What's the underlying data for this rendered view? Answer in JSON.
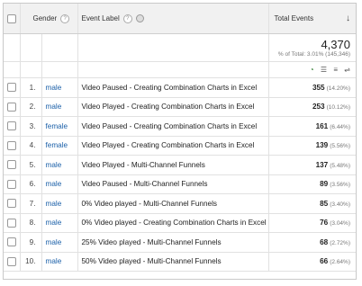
{
  "header": {
    "gender_label": "Gender",
    "gender_help": "?",
    "event_label": "Event Label",
    "event_help": "?",
    "total_label": "Total Events",
    "sort_glyph": "↓"
  },
  "summary": {
    "total": "4,370",
    "pct_text": "% of Total: 3.01% (145,346)"
  },
  "rows": [
    {
      "idx": "1.",
      "gender": "male",
      "label": "Video Paused - Creating Combination Charts in Excel",
      "value": "355",
      "pct": "(14.20%)"
    },
    {
      "idx": "2.",
      "gender": "male",
      "label": "Video Played - Creating Combination Charts in Excel",
      "value": "253",
      "pct": "(10.12%)"
    },
    {
      "idx": "3.",
      "gender": "female",
      "label": "Video Paused - Creating Combination Charts in Excel",
      "value": "161",
      "pct": "(6.44%)"
    },
    {
      "idx": "4.",
      "gender": "female",
      "label": "Video Played - Creating Combination Charts in Excel",
      "value": "139",
      "pct": "(5.56%)"
    },
    {
      "idx": "5.",
      "gender": "male",
      "label": "Video Played - Multi-Channel Funnels",
      "value": "137",
      "pct": "(5.48%)"
    },
    {
      "idx": "6.",
      "gender": "male",
      "label": "Video Paused - Multi-Channel Funnels",
      "value": "89",
      "pct": "(3.56%)"
    },
    {
      "idx": "7.",
      "gender": "male",
      "label": "0% Video played - Multi-Channel Funnels",
      "value": "85",
      "pct": "(3.40%)"
    },
    {
      "idx": "8.",
      "gender": "male",
      "label": "0% Video played - Creating Combination Charts in Excel",
      "value": "76",
      "pct": "(3.04%)"
    },
    {
      "idx": "9.",
      "gender": "male",
      "label": "25% Video played - Multi-Channel Funnels",
      "value": "68",
      "pct": "(2.72%)"
    },
    {
      "idx": "10.",
      "gender": "male",
      "label": "50% Video played - Multi-Channel Funnels",
      "value": "66",
      "pct": "(2.64%)"
    }
  ],
  "icons": {
    "pie": "pie-chart-icon",
    "bar": "bar-chart-icon",
    "compare": "comparison-icon",
    "pivot": "pivot-icon"
  },
  "colors": {
    "link": "#1a5fa8",
    "header_bg": "#f1f1f1"
  }
}
